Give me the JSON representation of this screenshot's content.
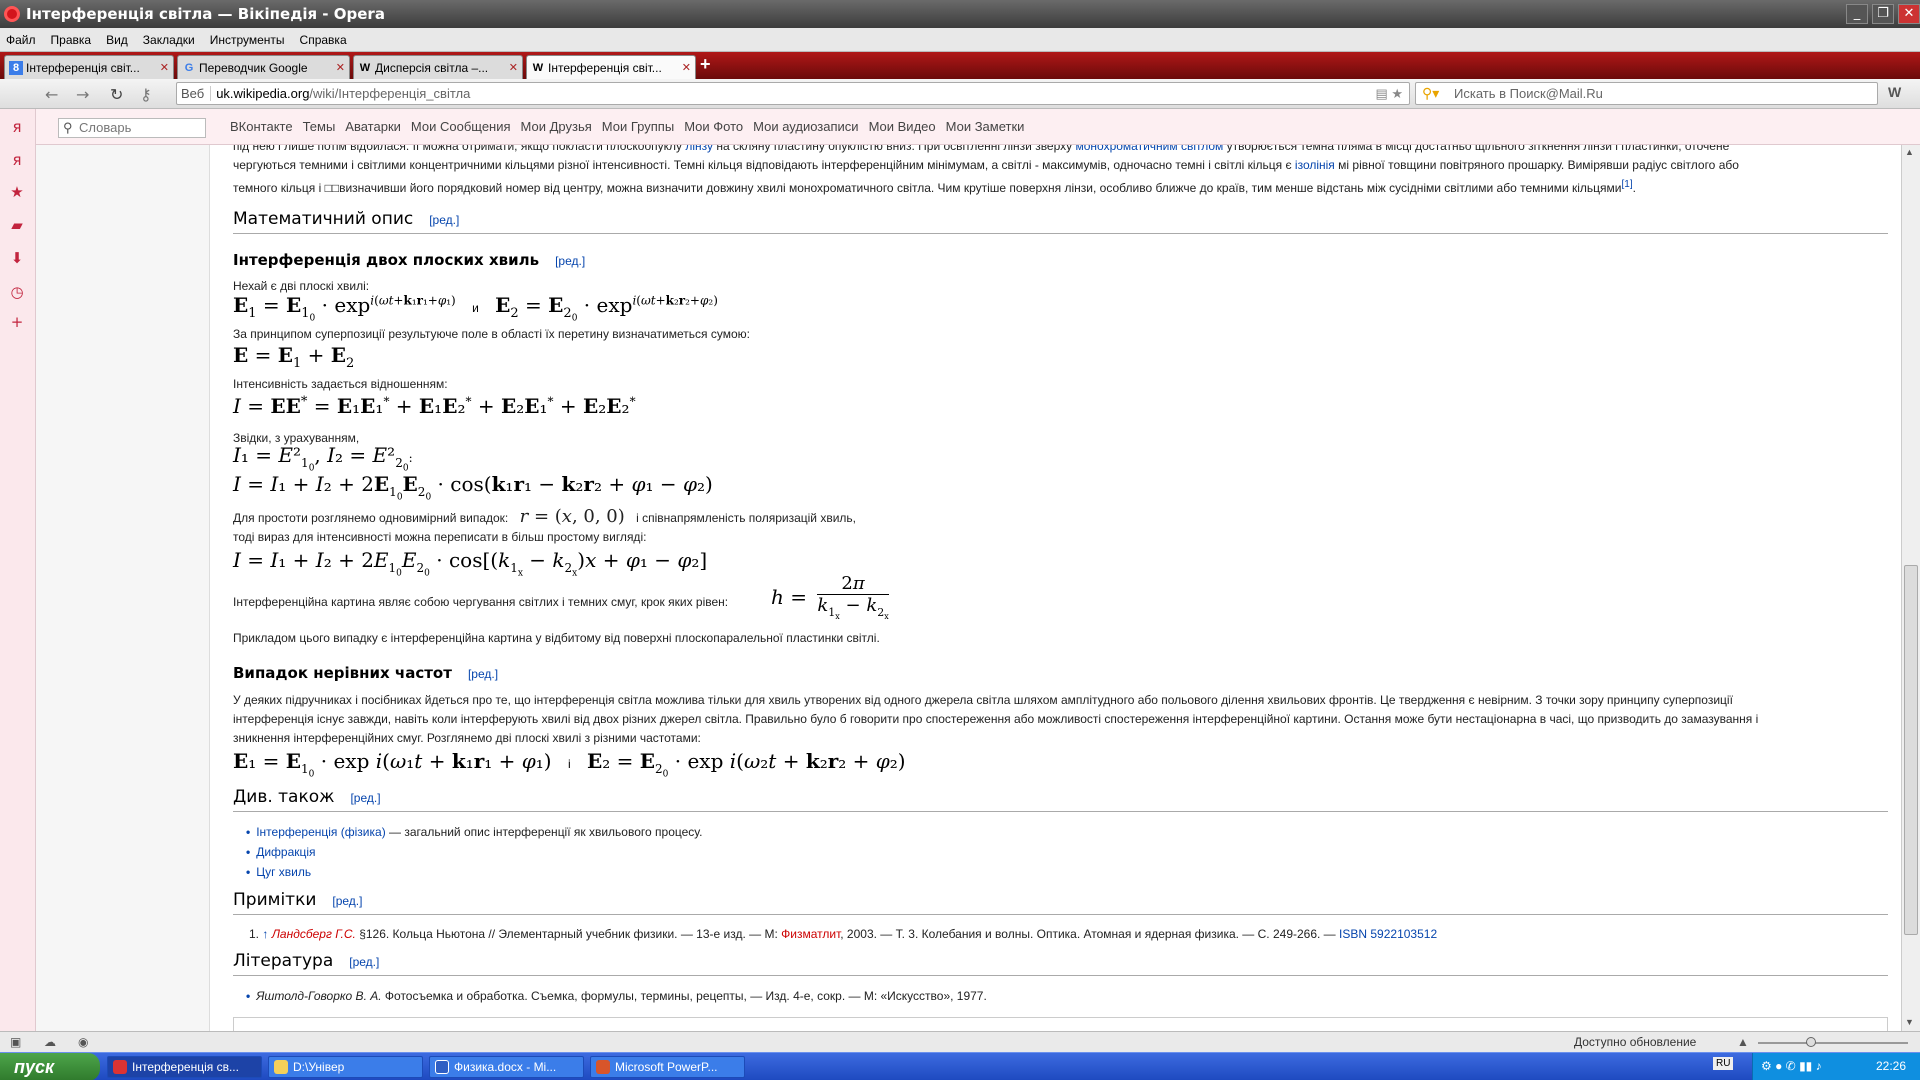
{
  "window": {
    "title": "Інтерференція світла — Вікіпедія - Opera"
  },
  "menu": [
    "Файл",
    "Правка",
    "Вид",
    "Закладки",
    "Инструменты",
    "Справка"
  ],
  "tabs": [
    {
      "icon": "8",
      "label": "Інтерференція світ..."
    },
    {
      "icon": "G",
      "label": "Переводчик Google"
    },
    {
      "icon": "W",
      "label": "Дисперсія світла –..."
    },
    {
      "icon": "W",
      "label": "Інтерференція світ..."
    }
  ],
  "address": {
    "web_label": "Веб",
    "domain": "uk.wikipedia.org",
    "path": "/wiki/Інтерференція_світла"
  },
  "search": {
    "placeholder": "Искать в Поиск@Mail.Ru"
  },
  "bookmarks": {
    "dict_placeholder": "Словарь",
    "links": [
      "ВКонтакте",
      "Темы",
      "Аватарки",
      "Мои Сообщения",
      "Мои Друзья",
      "Мои Группы",
      "Мои Фото",
      "Мои аудиозаписи",
      "Мои Видео",
      "Мои Заметки"
    ]
  },
  "article": {
    "intro1": "під нею і лише потім відбилася. Її можна отримати, якщо покласти плоскоопуклу",
    "intro_link1": "лінзу",
    "intro2": " на скляну пластину опуклістю вниз. При освітленні лінзи зверху ",
    "intro_link2": "монохроматичним світлом",
    "intro3": " утворюється темна пляма в місці достатньо щільного зіткнення лінзи і пластинки, оточене",
    "intro_line2a": "чергуються темними і світлими концентричними кільцями різної інтенсивності. Темні кільця відповідають інтерференційним мінімумам, а світлі - максимумів, одночасно темні і світлі кільця є ",
    "intro_link3": "ізолінія",
    "intro_line2b": " мі рівної товщини повітряного прошарку. Вимірявши радіус світлого або",
    "intro_line3": "темного кільця і □□визначивши його порядковий номер від центру, можна визначити довжину хвилі монохроматичного світла. Чим крутіше поверхня лінзи, особливо ближче до країв, тим менше відстань між сусідніми світлими або темними кільцями",
    "intro_ref": "[1]",
    "h_math": "Математичний опис",
    "edit": "[ред.]",
    "h_two": "Інтерференція двох плоских хвиль",
    "t_let": "Нехай є дві плоскі хвилі:",
    "and": "и",
    "t_super": "За принципом суперпозиції результуюче поле в області їх перетину визначатиметься сумою:",
    "t_int": "Інтенсивність задається відношенням:",
    "t_whence": "Звідки, з урахуванням,",
    "t_simple1": "Для простоти розглянемо одновимірний випадок:",
    "t_simple2": "і співнапрямленість поляризацій хвиль,",
    "t_then": "тоді вираз для інтенсивності можна переписати в більш простому вигляді:",
    "t_pattern": "Інтерференційна картина являє собою чергування світлих і темних смуг, крок яких рівен:",
    "t_example": "Прикладом цього випадку є інтерференційна картина у відбитому від поверхні плоскопаралельної пластинки світлі.",
    "h_unequal": "Випадок нерівних частот",
    "t_un1": "У деяких підручниках і посібниках йдеться про те, що інтерференція світла можлива тільки для хвиль утворених від одного джерела світла шляхом амплітудного або польового ділення хвильових фронтів. Це твердження є невірним. З точки зору принципу суперпозиції",
    "t_un2": "інтерференція існує завжди, навіть коли інтерферують хвилі від двох різних джерел світла. Правильно було б говорити про спостереження або можливості спостереження інтерференційної картини. Остання може бути нестаціонарна в часі, що призводить до замазування і",
    "t_un3": "зникнення інтерференційних смуг. Розглянемо дві плоскі хвилі з різними частотами:",
    "and2": "і",
    "h_see": "Див. також",
    "see": [
      {
        "link": "Інтерференція (фізика)",
        "rest": " — загальний опис інтерференції як хвильового процесу."
      },
      {
        "link": "Дифракція",
        "rest": ""
      },
      {
        "link": "Цуг хвиль",
        "rest": ""
      }
    ],
    "h_notes": "Примітки",
    "note_num": "1.",
    "note_arrow": "↑",
    "note_author": "Ландсберг Г.С.",
    "note_text": " §126. Кольца Ньютона // Элементарный учебник физики. — 13-е изд. — М: ",
    "note_pub": "Физматлит",
    "note_text2": ", 2003. — Т. 3. Колебания и волны. Оптика. Атомная и ядерная физика. — С. 249-266. — ",
    "note_isbn": "ISBN 5922103512",
    "h_lit": "Література",
    "lit_author": "Яштолд-Говорко В. А.",
    "lit_text": " Фотосъемка и обработка. Съемка, формулы, термины, рецепты, — Изд. 4-е, сокр. — М: «Искусство», 1977."
  },
  "status": {
    "update": "Доступно обновление"
  },
  "taskbar": {
    "start": "пуск",
    "items": [
      "Інтерференція св...",
      "D:\\Універ",
      "Физика.docx - Mi...",
      "Microsoft PowerP..."
    ],
    "lang": "RU",
    "clock": "22:26"
  }
}
